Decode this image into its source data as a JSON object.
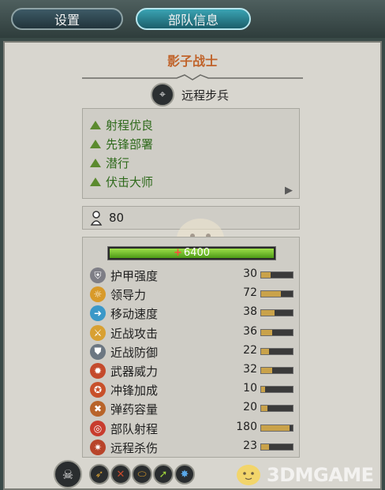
{
  "tabs": {
    "settings_label": "设置",
    "unit_info_label": "部队信息"
  },
  "unit": {
    "name": "影子战士",
    "class_label": "远程步兵",
    "count": "80",
    "hp": "6400"
  },
  "traits": [
    "射程优良",
    "先锋部署",
    "潜行",
    "伏击大师"
  ],
  "stats": [
    {
      "label": "护甲强度",
      "value": "30",
      "level": 0.3,
      "icon": "armor-icon",
      "color": "#7e7e86"
    },
    {
      "label": "领导力",
      "value": "72",
      "level": 0.62,
      "icon": "leadership-icon",
      "color": "#d89a2a"
    },
    {
      "label": "移动速度",
      "value": "38",
      "level": 0.42,
      "icon": "speed-icon",
      "color": "#3b98c8"
    },
    {
      "label": "近战攻击",
      "value": "36",
      "level": 0.36,
      "icon": "melee-attack-icon",
      "color": "#d8a032"
    },
    {
      "label": "近战防御",
      "value": "22",
      "level": 0.24,
      "icon": "melee-defense-icon",
      "color": "#6c7782"
    },
    {
      "label": "武器威力",
      "value": "32",
      "level": 0.34,
      "icon": "weapon-strength-icon",
      "color": "#c44a2c"
    },
    {
      "label": "冲锋加成",
      "value": "10",
      "level": 0.12,
      "icon": "charge-bonus-icon",
      "color": "#c8502a"
    },
    {
      "label": "弹药容量",
      "value": "20",
      "level": 0.2,
      "icon": "ammunition-icon",
      "color": "#b8642a"
    },
    {
      "label": "部队射程",
      "value": "180",
      "level": 0.9,
      "icon": "range-icon",
      "color": "#c83c2e"
    },
    {
      "label": "远程杀伤",
      "value": "23",
      "level": 0.26,
      "icon": "missile-damage-icon",
      "color": "#b8442a"
    }
  ],
  "abilities": [
    "bow-ability-icon",
    "dual-blades-ability-icon",
    "shield-break-ability-icon",
    "spear-ability-icon",
    "magic-ability-icon"
  ],
  "watermark": "3DMGAME",
  "colors": {
    "title": "#c0632a",
    "trait_text": "#2f6a1c",
    "hp_green": "#7cc63a",
    "stat_bar": "#c9a24a"
  }
}
